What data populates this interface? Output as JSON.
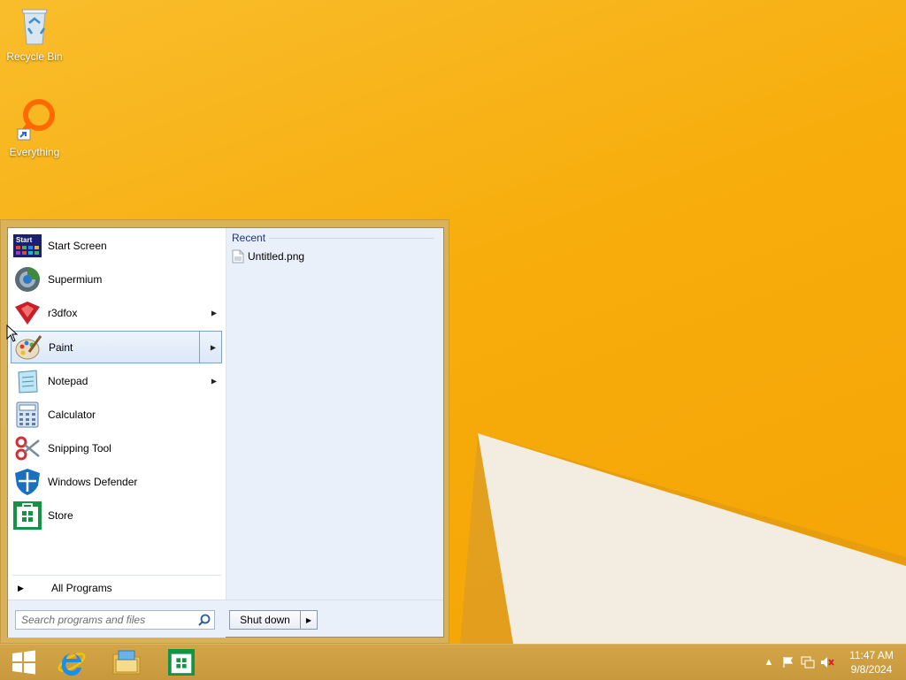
{
  "desktop": {
    "icons": [
      {
        "label": "Recycle Bin",
        "icon": "recycle-bin-icon"
      },
      {
        "label": "Everything",
        "icon": "everything-search-icon"
      }
    ]
  },
  "start_menu": {
    "pinned": [
      {
        "label": "Start Screen",
        "icon": "start-screen-icon",
        "has_submenu": false
      },
      {
        "label": "Supermium",
        "icon": "supermium-browser-icon",
        "has_submenu": false
      },
      {
        "label": "r3dfox",
        "icon": "r3dfox-browser-icon",
        "has_submenu": true
      },
      {
        "label": "Paint",
        "icon": "paint-icon",
        "has_submenu": true,
        "selected": true
      },
      {
        "label": "Notepad",
        "icon": "notepad-icon",
        "has_submenu": true
      },
      {
        "label": "Calculator",
        "icon": "calculator-icon",
        "has_submenu": false
      },
      {
        "label": "Snipping Tool",
        "icon": "snipping-tool-icon",
        "has_submenu": false
      },
      {
        "label": "Windows Defender",
        "icon": "windows-defender-icon",
        "has_submenu": false
      },
      {
        "label": "Store",
        "icon": "store-icon",
        "has_submenu": false
      }
    ],
    "start_screen_tile_text": "Start",
    "all_programs_label": "All Programs",
    "recent": {
      "header": "Recent",
      "items": [
        {
          "label": "Untitled.png",
          "icon": "image-file-icon"
        }
      ]
    },
    "search": {
      "placeholder": "Search programs and files",
      "value": ""
    },
    "shutdown_label": "Shut down"
  },
  "taskbar": {
    "buttons": [
      {
        "name": "start",
        "icon": "windows-logo-icon"
      },
      {
        "name": "internet-explorer",
        "icon": "internet-explorer-icon"
      },
      {
        "name": "file-explorer",
        "icon": "file-explorer-icon"
      },
      {
        "name": "store",
        "icon": "store-icon"
      }
    ],
    "clock": {
      "time": "11:47 AM",
      "date": "9/8/2024"
    }
  },
  "colors": {
    "desktop_bg": "#f7ad0c",
    "taskbar_bg": "#cb9c3f",
    "menu_frame": "#d6b260",
    "menu_right_pane": "#e9f0f9",
    "selection_border": "#7da2ce"
  }
}
